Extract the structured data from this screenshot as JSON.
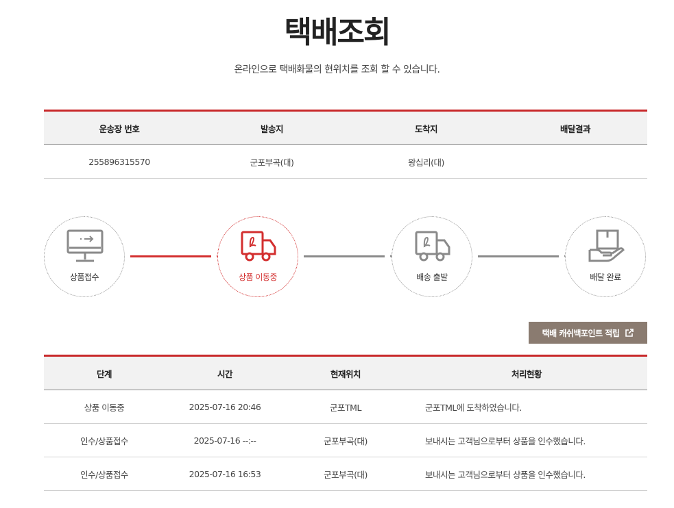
{
  "header": {
    "title": "택배조회",
    "subtitle": "온라인으로 택배화물의 현위치를 조회 할 수 있습니다."
  },
  "shipment": {
    "columns": [
      "운송장 번호",
      "발송지",
      "도착지",
      "배달결과"
    ],
    "row": [
      "255896315570",
      "군포부곡(대)",
      "왕십리(대)",
      ""
    ]
  },
  "steps": {
    "items": [
      {
        "label": "상품접수",
        "icon": "monitor-icon",
        "status": "done"
      },
      {
        "label": "상품 이동중",
        "icon": "truck-icon",
        "status": "current"
      },
      {
        "label": "배송 출발",
        "icon": "truck-icon",
        "status": "pending"
      },
      {
        "label": "배달 완료",
        "icon": "hand-box-icon",
        "status": "pending"
      }
    ],
    "colors": {
      "active": "#d32f2f",
      "inactive": "#8a8a8a"
    }
  },
  "cashback": {
    "label": "택배 캐쉬백포인트 적립",
    "icon": "external-link-icon"
  },
  "tracking": {
    "columns": [
      "단계",
      "시간",
      "현재위치",
      "처리현황"
    ],
    "rows": [
      [
        "상품 이동중",
        "2025-07-16 20:46",
        "군포TML",
        "군포TML에 도착하였습니다."
      ],
      [
        "인수/상품접수",
        "2025-07-16 --:--",
        "군포부곡(대)",
        "보내시는 고객님으로부터 상품을 인수했습니다."
      ],
      [
        "인수/상품접수",
        "2025-07-16 16:53",
        "군포부곡(대)",
        "보내시는 고객님으로부터 상품을 인수했습니다."
      ]
    ]
  },
  "colors": {
    "accent": "#c8282a",
    "button": "#8a7b70",
    "header_bg": "#f2f2f2"
  }
}
